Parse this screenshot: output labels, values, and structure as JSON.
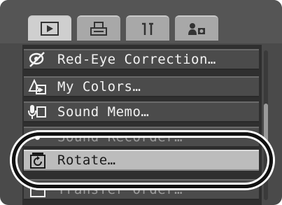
{
  "tabs": [
    {
      "name": "playback-icon",
      "active": true
    },
    {
      "name": "print-icon",
      "active": false
    },
    {
      "name": "tools-icon",
      "active": false
    },
    {
      "name": "my-camera-icon",
      "active": false
    }
  ],
  "menu": {
    "items": [
      {
        "label": "Red-Eye Correction…",
        "icon": "red-eye-icon"
      },
      {
        "label": "My Colors…",
        "icon": "my-colors-icon"
      },
      {
        "label": "Sound Memo…",
        "icon": "sound-memo-icon"
      },
      {
        "label": "Sound Recorder…",
        "icon": "sound-recorder-icon"
      },
      {
        "label": "Rotate…",
        "icon": "rotate-icon",
        "selected": true
      },
      {
        "label": "Transfer Order…",
        "icon": "transfer-order-icon"
      }
    ]
  },
  "colors": {
    "highlight": "#bcbcbc",
    "item_background": "#4b4b4b",
    "text": "#f2f2f2"
  }
}
